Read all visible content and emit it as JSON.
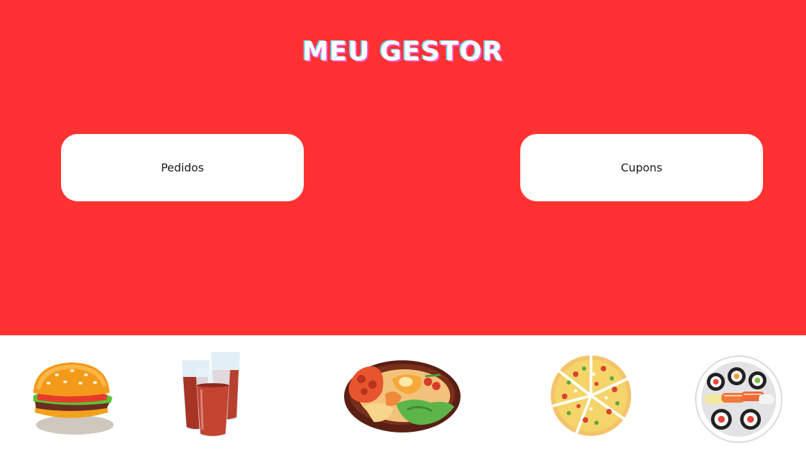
{
  "header": {
    "title": "MEU GESTOR"
  },
  "menu": {
    "pedidos_label": "Pedidos",
    "cupons_label": "Cupons"
  },
  "colors": {
    "background": "#ff3131",
    "card": "#ffffff"
  },
  "footer": {
    "illustrations": [
      "burger-icon",
      "soda-glasses-icon",
      "food-bowl-icon",
      "pizza-icon",
      "sushi-plate-icon"
    ]
  }
}
